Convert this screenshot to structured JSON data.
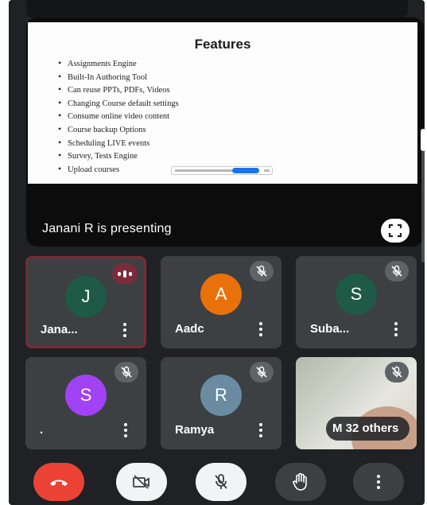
{
  "slide": {
    "title": "Features",
    "items": [
      "Assignments Engine",
      "Built-In Authoring Tool",
      "Can reuse PPTs, PDFs, Videos",
      "Changing Course default settings",
      "Consume online video content",
      "Course backup Options",
      "Scheduling LIVE events",
      "Survey, Tests Engine",
      "Upload courses"
    ]
  },
  "presenting_label": "Janani R is presenting",
  "participants": [
    {
      "name": "Jana...",
      "initial": "J",
      "avatar_color": "#1e5a45",
      "status": "speaking"
    },
    {
      "name": "Aadc",
      "initial": "A",
      "avatar_color": "#e8710a",
      "status": "muted"
    },
    {
      "name": "Suba...",
      "initial": "S",
      "avatar_color": "#1e5a45",
      "status": "muted"
    },
    {
      "name": ".",
      "initial": "S",
      "avatar_color": "#a142f4",
      "status": "muted"
    },
    {
      "name": "Ramya",
      "initial": "R",
      "avatar_color": "#6a8ba1",
      "status": "muted"
    },
    {
      "name": "M",
      "status": "muted",
      "others_label": "32 others"
    }
  ],
  "controls": [
    {
      "name": "end-call",
      "icon": "phone-hangup-icon"
    },
    {
      "name": "camera-off",
      "icon": "videocam-off-icon"
    },
    {
      "name": "mic-off",
      "icon": "mic-off-icon"
    },
    {
      "name": "raise-hand",
      "icon": "hand-icon"
    },
    {
      "name": "more-options",
      "icon": "more-vert-icon"
    }
  ],
  "colors": {
    "background": "#202124",
    "tile": "#3c4043",
    "end_call": "#ea4335",
    "active_border": "#7a2a33",
    "accent_blue": "#1a73e8"
  }
}
